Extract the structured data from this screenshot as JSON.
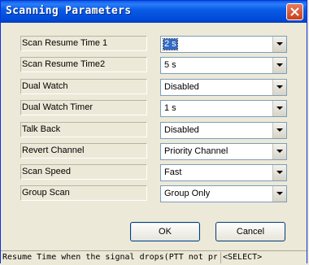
{
  "window": {
    "title": "Scanning Parameters"
  },
  "fields": [
    {
      "label": "Scan Resume Time 1",
      "value": "2 s"
    },
    {
      "label": "Scan Resume Time2",
      "value": "5 s"
    },
    {
      "label": "Dual Watch",
      "value": "Disabled"
    },
    {
      "label": "Dual Watch Timer",
      "value": "1 s"
    },
    {
      "label": "Talk Back",
      "value": "Disabled"
    },
    {
      "label": "Revert Channel",
      "value": "Priority Channel"
    },
    {
      "label": "Scan Speed",
      "value": "Fast"
    },
    {
      "label": "Group Scan",
      "value": "Group Only"
    }
  ],
  "buttons": {
    "ok": "OK",
    "cancel": "Cancel"
  },
  "statusbar": {
    "message": "Resume Time when the signal drops(PTT not pr",
    "mode": "<SELECT>"
  }
}
